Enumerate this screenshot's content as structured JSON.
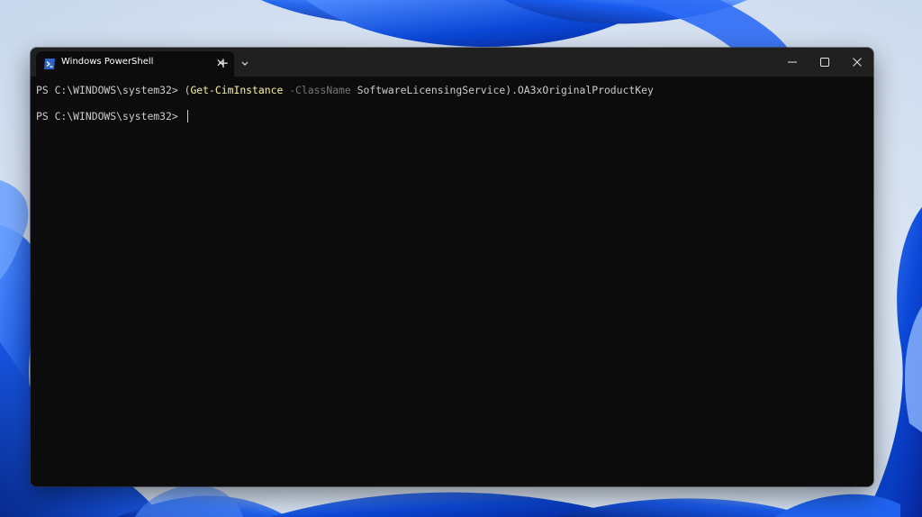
{
  "window": {
    "tab_title": "Windows PowerShell",
    "tab_icon": "powershell-icon",
    "new_tab_symbol": "+",
    "close_tab_symbol": "✕",
    "controls": [
      "minimize-icon",
      "maximize-icon",
      "close-icon"
    ]
  },
  "console": {
    "line1": {
      "prompt": "PS C:\\WINDOWS\\system32> ",
      "open_paren": "(",
      "cmdlet": "Get-CimInstance",
      "space1": " ",
      "parameter": "-ClassName",
      "space2": " ",
      "argument": "SoftwareLicensingService",
      "tail": ").OA3xOriginalProductKey"
    },
    "line2": {
      "prompt": "PS C:\\WINDOWS\\system32> "
    }
  },
  "colors": {
    "console_background": "#0c0c0c",
    "titlebar_background": "#202020",
    "default_text": "#cccccc",
    "cmdlet_text": "#f9f1a5",
    "parameter_text": "#767676",
    "wallpaper_accent": "#0a4fe0"
  }
}
